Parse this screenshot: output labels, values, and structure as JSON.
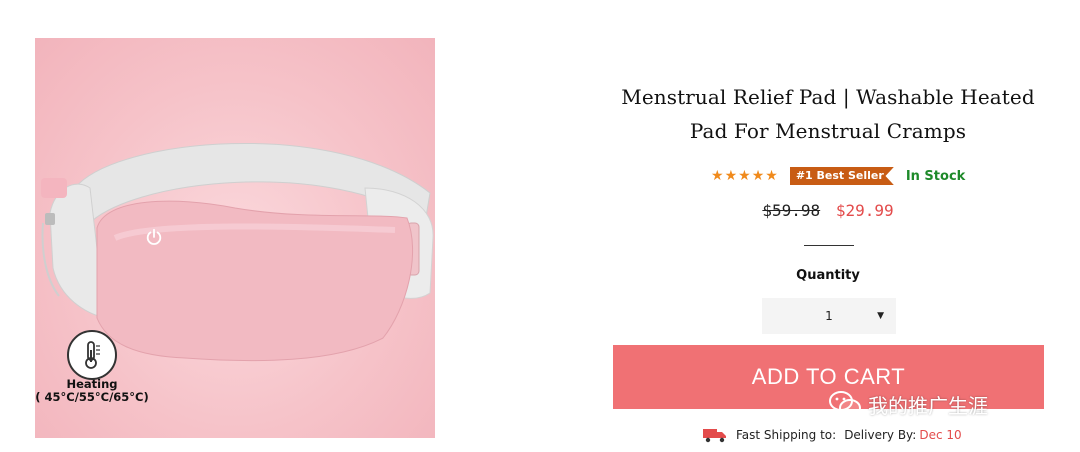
{
  "product": {
    "title_line1": "Menstrual Relief Pad | Washable Heated",
    "title_line2": "Pad For Menstrual Cramps",
    "rating_stars": 5,
    "badge": "#1 Best Seller",
    "stock_status": "In Stock",
    "old_price": "$59.98",
    "new_price": "$29.99",
    "icons": {
      "power": "power-icon",
      "thermometer": "thermometer-icon",
      "truck": "delivery-truck-icon",
      "wechat": "wechat-icon"
    }
  },
  "image_overlay": {
    "heating_title": "Heating",
    "heating_temps": "( 45°C/55°C/65°C)"
  },
  "quantity": {
    "label": "Quantity",
    "value": "1"
  },
  "cart": {
    "button_label": "ADD TO CART"
  },
  "shipping": {
    "fast_label": "Fast Shipping to:",
    "delivery_label": "Delivery By:",
    "delivery_date": "Dec 10"
  },
  "watermark": {
    "text": "我的推广生涯"
  },
  "colors": {
    "accent": "#f07174",
    "price_sale": "#e34b4b",
    "in_stock": "#1e8a2a",
    "badge": "#c85c14",
    "stars": "#f08a1c"
  }
}
